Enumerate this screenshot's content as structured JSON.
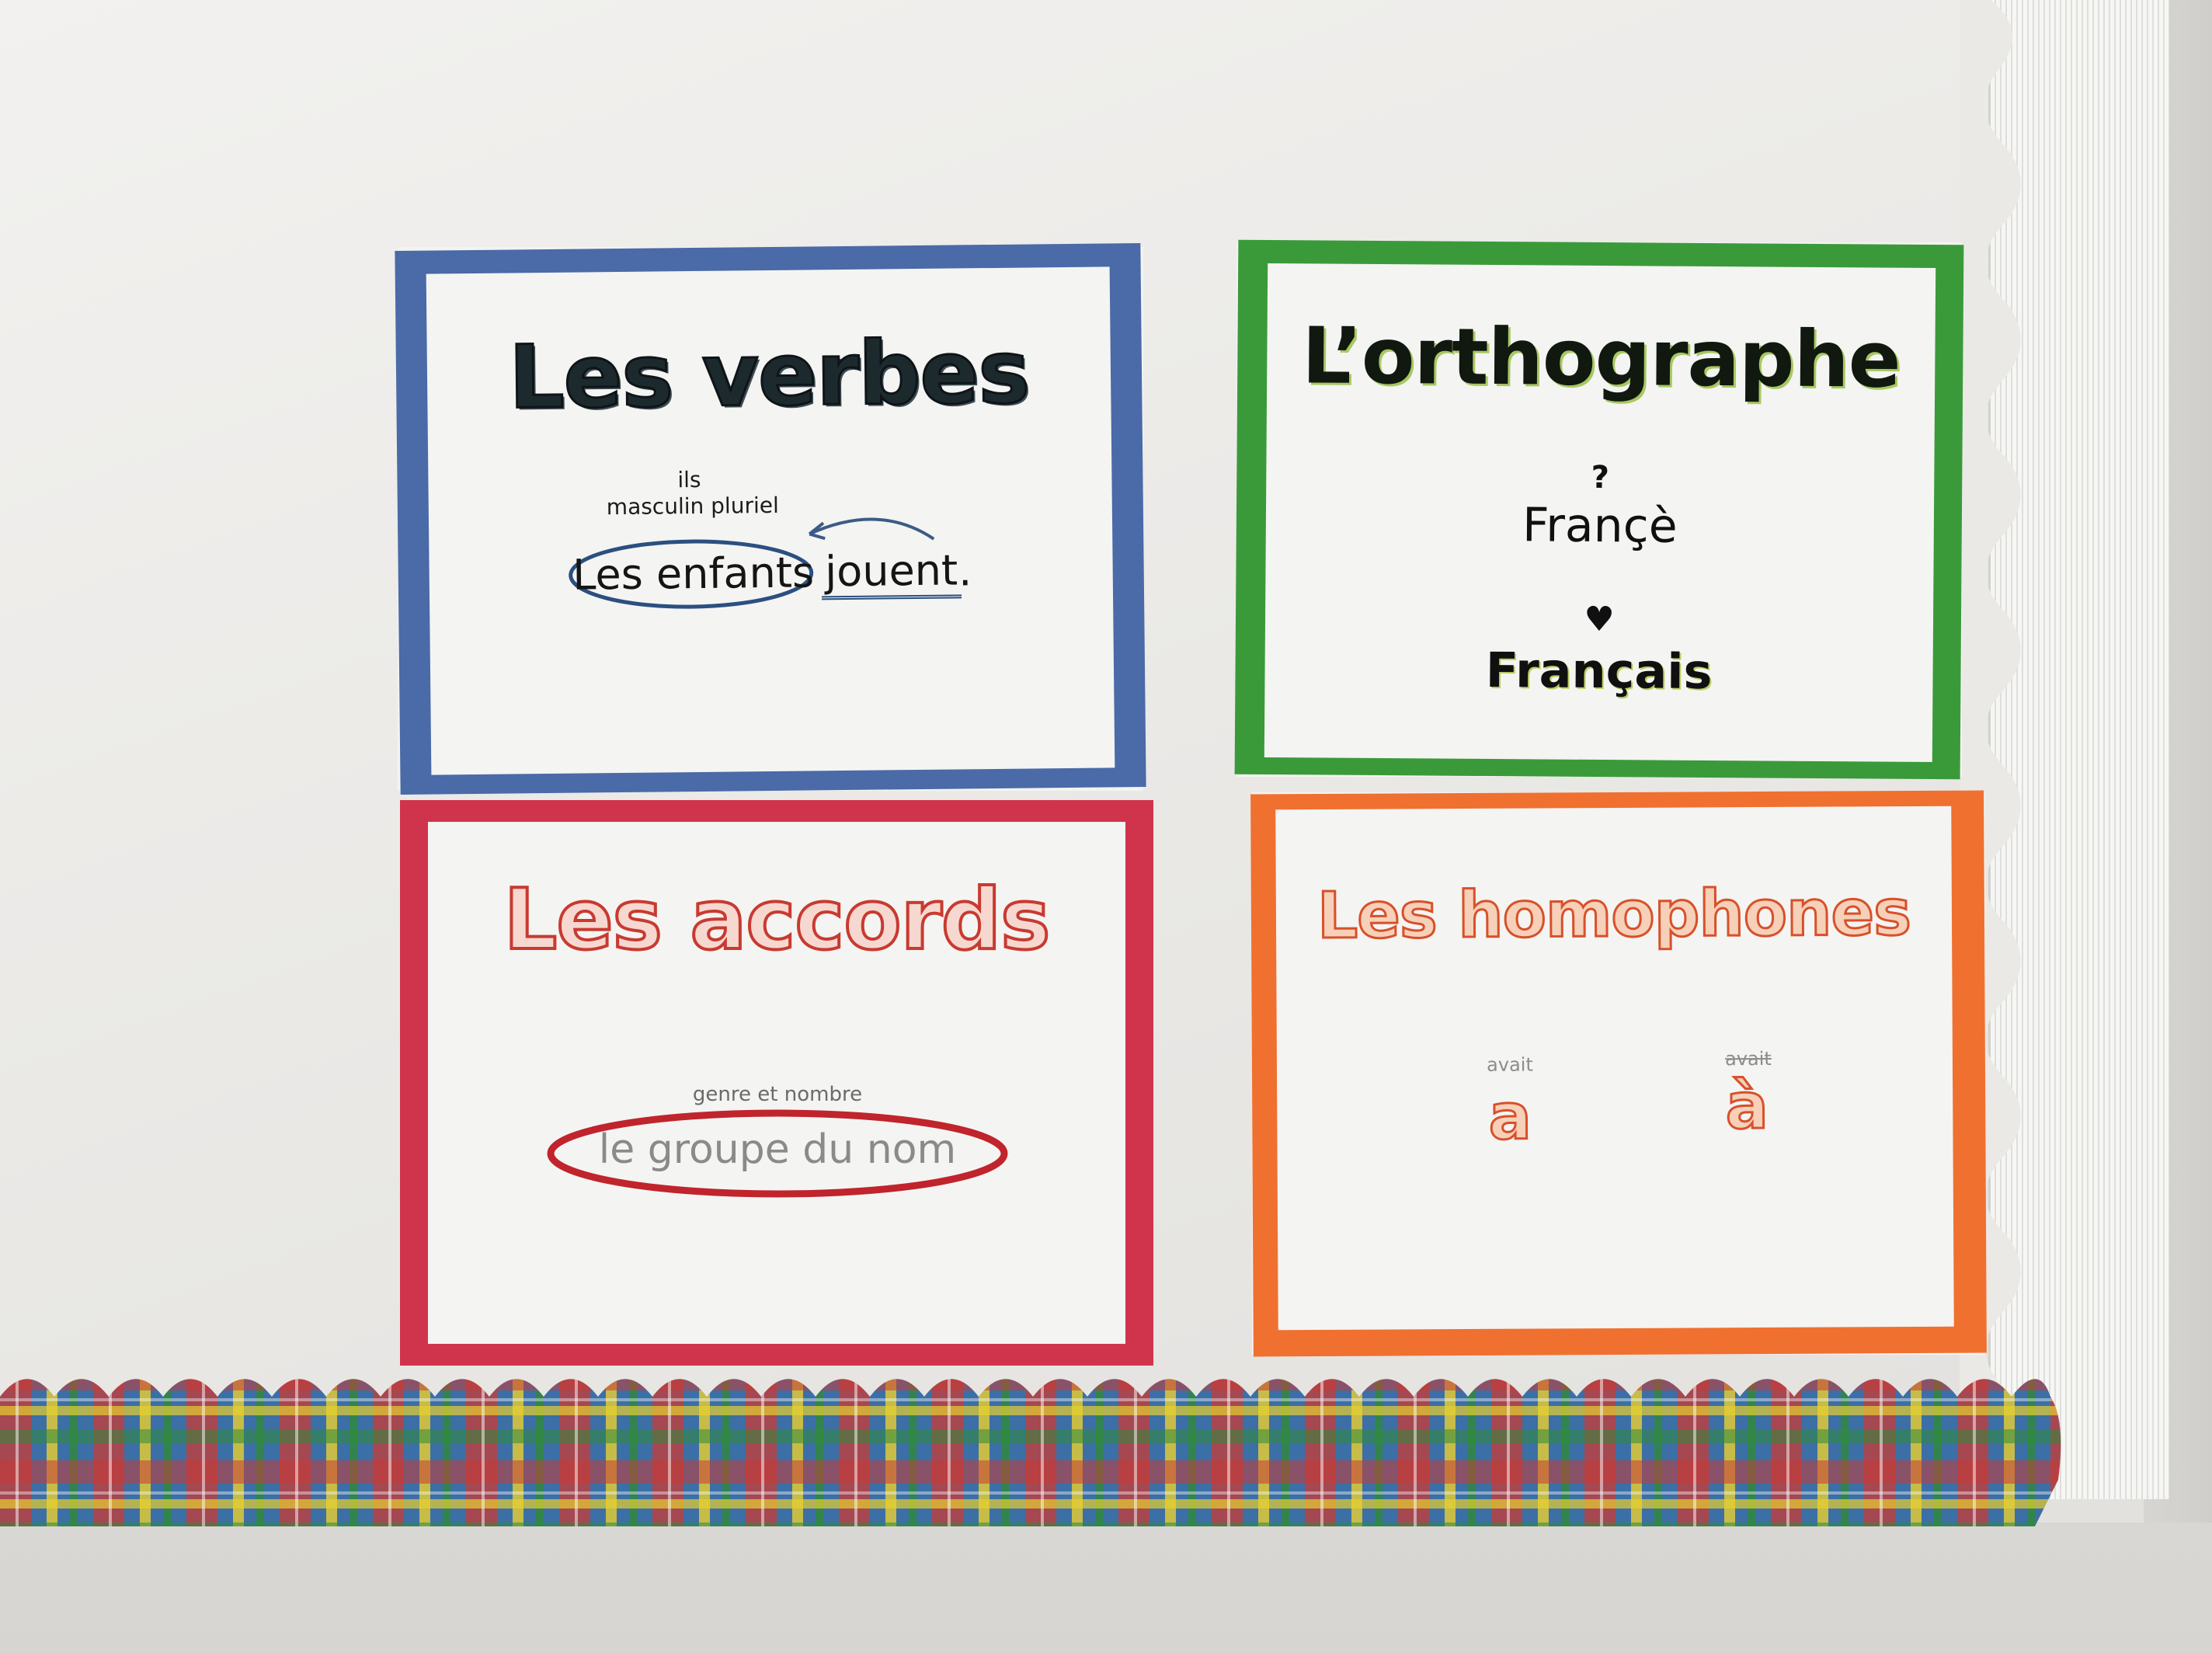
{
  "posters": {
    "verbes": {
      "title": "Les verbes",
      "annot_ils": "ils",
      "annot_masc": "masculin pluriel",
      "subject": "Les enfants",
      "verb": "jouent",
      "period": "."
    },
    "orthographe": {
      "title": "L’orthographe",
      "question_mark": "?",
      "wrong_spelling": "Françè",
      "correct_spelling": "Français"
    },
    "accords": {
      "title": "Les accords",
      "annot": "genre et nombre",
      "phrase": "le groupe du nom"
    },
    "homophones": {
      "title": "Les homophones",
      "left_hint": "avait",
      "left_word": "a",
      "right_hint": "avait",
      "right_word": "à"
    }
  },
  "colors": {
    "blue_frame": "#4a6aa8",
    "green_frame": "#3a9a3a",
    "red_frame": "#d0344c",
    "orange_frame": "#f07030"
  }
}
